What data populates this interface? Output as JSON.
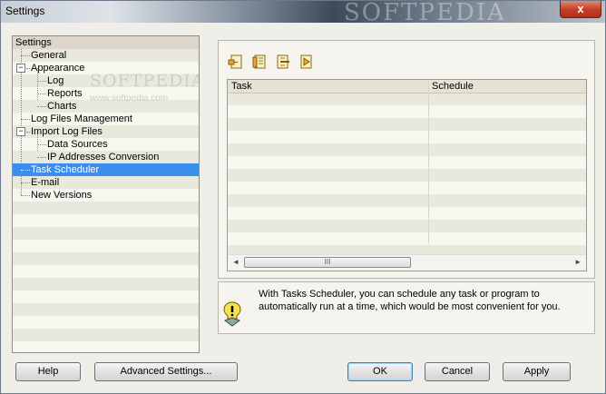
{
  "window": {
    "title": "Settings",
    "watermark": "SOFTPEDIA",
    "close_label": "x"
  },
  "tree": {
    "watermark": "SOFTPEDIA",
    "watermark_sub": "www.softpedia.com",
    "root": "Settings",
    "items": [
      {
        "label": "General"
      },
      {
        "label": "Appearance",
        "expander": "−"
      },
      {
        "label": "Log"
      },
      {
        "label": "Reports"
      },
      {
        "label": "Charts"
      },
      {
        "label": "Log Files Management"
      },
      {
        "label": "Import Log Files",
        "expander": "−"
      },
      {
        "label": "Data Sources"
      },
      {
        "label": "IP Addresses Conversion"
      },
      {
        "label": "Task Scheduler",
        "selected": true
      },
      {
        "label": "E-mail"
      },
      {
        "label": "New Versions"
      }
    ]
  },
  "toolbar": {
    "icons": [
      "add-task-icon",
      "edit-task-icon",
      "delete-task-icon",
      "run-task-icon"
    ]
  },
  "grid": {
    "columns": [
      "Task",
      "Schedule"
    ],
    "scroll_left": "◄",
    "scroll_right": "►",
    "scroll_grip": "III"
  },
  "info": {
    "text": "With Tasks Scheduler, you can schedule any task or program to automatically run at a time, which would be most convenient for you."
  },
  "buttons": {
    "help": "Help",
    "advanced": "Advanced Settings...",
    "ok": "OK",
    "cancel": "Cancel",
    "apply": "Apply"
  },
  "colors": {
    "selection": "#3a8ef0",
    "stripe_light": "#f7f6ef",
    "stripe_dark": "#e9e8dd"
  }
}
